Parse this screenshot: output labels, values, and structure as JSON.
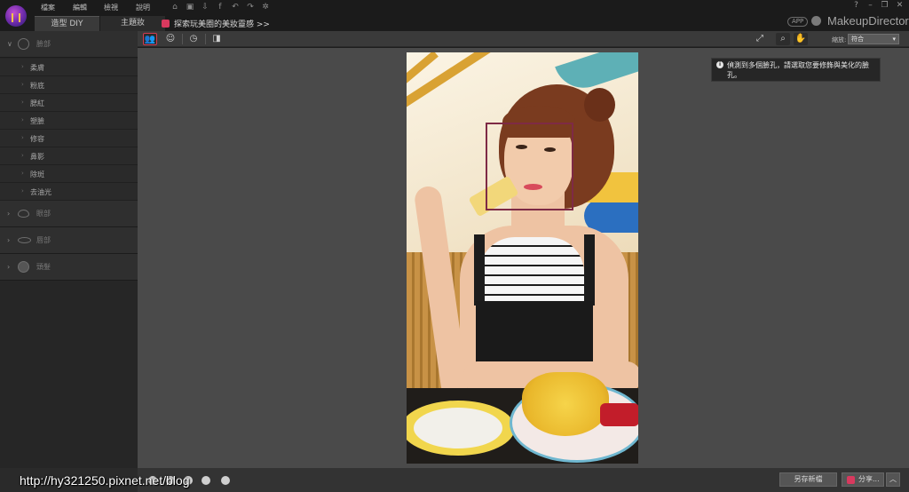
{
  "menu": [
    {
      "label": "檔案"
    },
    {
      "label": "編輯"
    },
    {
      "label": "檢視"
    },
    {
      "label": "說明"
    }
  ],
  "tabs": [
    {
      "label": "造型 DIY"
    },
    {
      "label": "主題妝"
    }
  ],
  "promo_link": "探索玩美圈的美妝靈感 >>",
  "app_badge": "APP",
  "brand": "MakeupDirector",
  "window_buttons": [
    "?",
    "–",
    "❐",
    "✕"
  ],
  "left_panel": {
    "categories": [
      {
        "label": "臉部",
        "icon": "face-icon",
        "expanded": true
      },
      {
        "label": "眼部",
        "icon": "eye-icon",
        "expanded": false
      },
      {
        "label": "唇部",
        "icon": "lips-icon",
        "expanded": false
      },
      {
        "label": "頭髮",
        "icon": "hair-icon",
        "expanded": false
      }
    ],
    "face_items": [
      "柔膚",
      "粉底",
      "腮紅",
      "塑臉",
      "修容",
      "鼻影",
      "除斑",
      "去油光"
    ]
  },
  "toolbar": {
    "zoom_label": "縮放:",
    "zoom_value": "符合",
    "tools": [
      "face-detect-icon",
      "face-outline-icon",
      "history-icon",
      "compare-icon",
      "fit-icon",
      "zoom-icon",
      "pan-hand-icon"
    ]
  },
  "notice": {
    "text": "偵測到多個臉孔，請選取您要修飾與美化的臉孔。"
  },
  "bottom": {
    "save_new": "另存新檔",
    "share": "分享..."
  },
  "watermark": "http://hy321250.pixnet.net/blog",
  "colors": {
    "accent": "#d23b4f",
    "face_box": "#7e2a45",
    "canvas_bg": "#4a4a4a"
  }
}
